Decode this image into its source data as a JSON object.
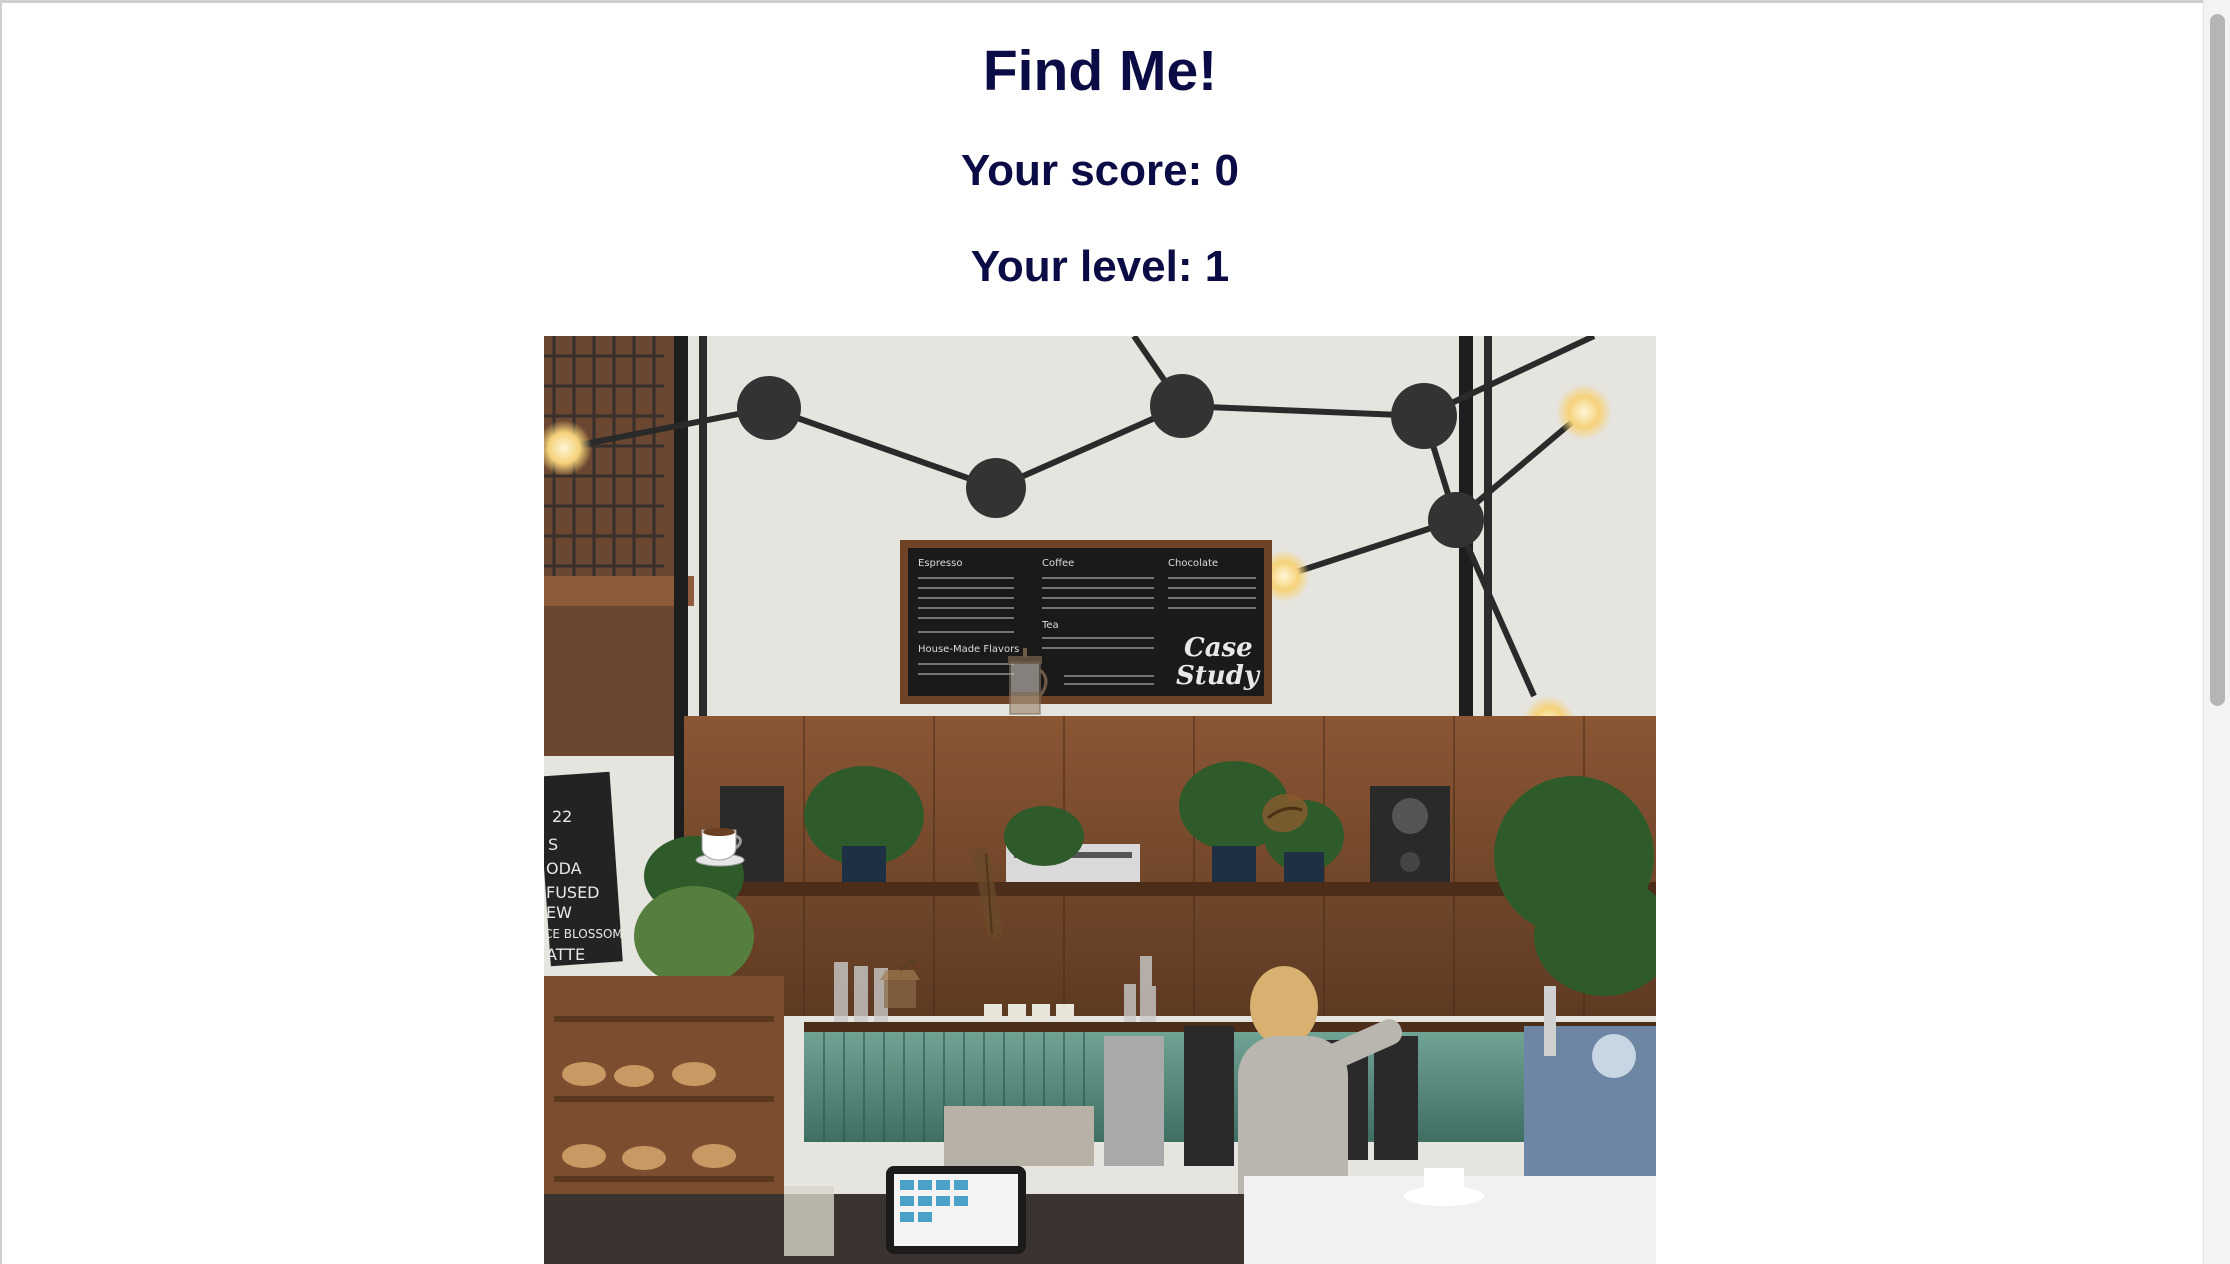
{
  "game": {
    "title": "Find Me!",
    "score_text": "Your score: 0",
    "level_text": "Your level: 1",
    "score": 0,
    "level": 1
  },
  "scene": {
    "menu_board": {
      "sign_line1": "Case",
      "sign_line2": "Study",
      "headings": [
        "Espresso",
        "Coffee",
        "Chocolate",
        "Tea",
        "House-Made Flavors"
      ]
    },
    "side_sign_lines": [
      "22",
      "S",
      "ODA",
      "FUSED",
      "EW",
      "CE BLOSSOM",
      "ATTE"
    ]
  },
  "hidden_objects": [
    {
      "name": "french-press",
      "icon": "french-press-icon"
    },
    {
      "name": "coffee-cup",
      "icon": "coffee-cup-icon"
    },
    {
      "name": "coffee-bean",
      "icon": "coffee-bean-icon"
    },
    {
      "name": "cinnamon-stick",
      "icon": "cinnamon-stick-icon"
    },
    {
      "name": "coffee-grinder",
      "icon": "coffee-grinder-icon"
    }
  ],
  "colors": {
    "heading": "#0b0b45",
    "wall": "#e9e7e2",
    "wood_panel": "#7a4a2e",
    "chalkboard": "#1c1a18"
  }
}
